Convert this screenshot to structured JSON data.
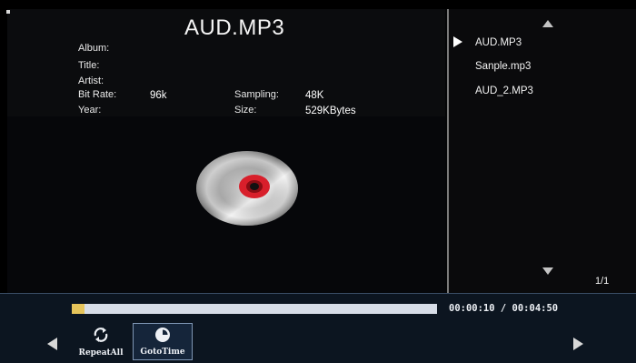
{
  "player": {
    "title": "AUD.MP3",
    "info": {
      "album_label": "Album:",
      "title_label": "Title:",
      "artist_label": "Artist:",
      "bitrate_label": "Bit Rate:",
      "bitrate_value": "96k",
      "year_label": "Year:",
      "sampling_label": "Sampling:",
      "sampling_value": "48K",
      "size_label": "Size:",
      "size_value": "529KBytes"
    }
  },
  "playlist": {
    "items": [
      {
        "name": "AUD.MP3",
        "selected": true
      },
      {
        "name": "Sanple.mp3",
        "selected": false
      },
      {
        "name": "AUD_2.MP3",
        "selected": false
      }
    ],
    "page": "1/1"
  },
  "controls": {
    "progress_fraction": 0.034,
    "time_display": "00:00:10 / 00:04:50",
    "buttons": [
      {
        "label": "RepeatAll",
        "icon": "repeat-icon"
      },
      {
        "label": "GotoTime",
        "icon": "clock-icon",
        "focused": true
      }
    ],
    "prev_icon": "triangle-left-icon",
    "next_icon": "triangle-right-icon"
  },
  "colors": {
    "progress_fill": "#e6c45a",
    "progress_track": "#d7dde7",
    "disc_center": "#d81f2b"
  }
}
